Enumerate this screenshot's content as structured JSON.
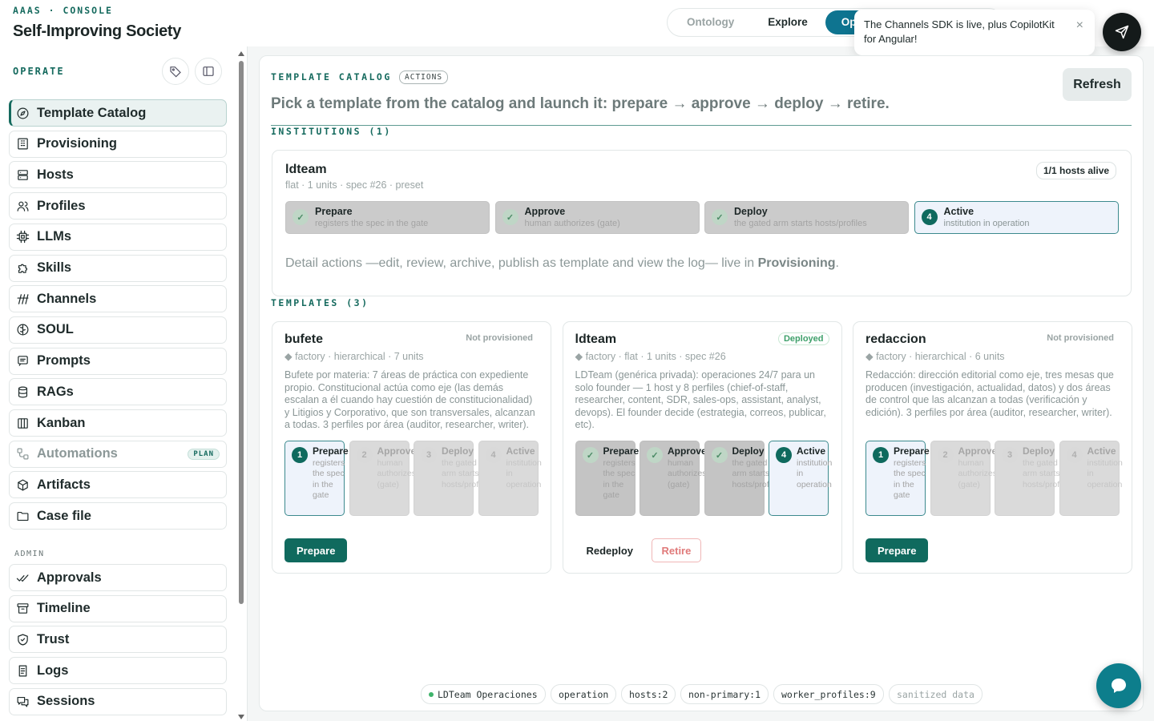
{
  "header": {
    "console_label": "AAAS · CONSOLE",
    "app_title": "Self-Improving Society",
    "nav": [
      {
        "label": "Ontology",
        "state": "dim"
      },
      {
        "label": "Explore",
        "state": "normal"
      },
      {
        "label": "Operate",
        "state": "active"
      }
    ]
  },
  "toast": {
    "message": "The Channels SDK is live, plus CopilotKit for Angular!",
    "close_label": "×"
  },
  "sidebar": {
    "operate_title": "OPERATE",
    "admin_title": "ADMIN",
    "operate_items": [
      {
        "label": "Template Catalog",
        "icon": "compass-icon",
        "active": true
      },
      {
        "label": "Provisioning",
        "icon": "building-icon"
      },
      {
        "label": "Hosts",
        "icon": "server-icon"
      },
      {
        "label": "Profiles",
        "icon": "users-icon"
      },
      {
        "label": "LLMs",
        "icon": "chip-icon"
      },
      {
        "label": "Skills",
        "icon": "puzzle-icon"
      },
      {
        "label": "Channels",
        "icon": "signal-icon"
      },
      {
        "label": "SOUL",
        "icon": "brain-icon"
      },
      {
        "label": "Prompts",
        "icon": "message-icon"
      },
      {
        "label": "RAGs",
        "icon": "database-icon"
      },
      {
        "label": "Kanban",
        "icon": "kanban-icon"
      },
      {
        "label": "Automations",
        "icon": "workflow-icon",
        "badge": "PLAN",
        "muted": true
      },
      {
        "label": "Artifacts",
        "icon": "package-icon"
      },
      {
        "label": "Case file",
        "icon": "folder-icon"
      }
    ],
    "admin_items": [
      {
        "label": "Approvals",
        "icon": "check-double-icon"
      },
      {
        "label": "Timeline",
        "icon": "archive-icon"
      },
      {
        "label": "Trust",
        "icon": "shield-icon"
      },
      {
        "label": "Logs",
        "icon": "scroll-icon"
      },
      {
        "label": "Sessions",
        "icon": "chat-icon"
      }
    ]
  },
  "main": {
    "section_title": "TEMPLATE CATALOG",
    "actions_badge": "ACTIONS",
    "refresh_label": "Refresh",
    "subtitle": "Pick a template from the catalog and launch it: prepare → approve → deploy → retire.",
    "institutions_title": "INSTITUTIONS (1)",
    "templates_title": "TEMPLATES (3)",
    "institution": {
      "name": "ldteam",
      "meta": "flat · 1 units · spec #26 · preset",
      "hosts_badge": "1/1 hosts alive",
      "stages": [
        {
          "name": "Prepare",
          "desc": "registers the spec in the gate",
          "state": "done",
          "mark": "✓"
        },
        {
          "name": "Approve",
          "desc": "human authorizes (gate)",
          "state": "done",
          "mark": "✓"
        },
        {
          "name": "Deploy",
          "desc": "the gated arm starts hosts/profiles",
          "state": "done",
          "mark": "✓"
        },
        {
          "name": "Active",
          "desc": "institution in operation",
          "state": "current",
          "mark": "4"
        }
      ],
      "detail_prefix": "Detail actions —edit, review, archive, publish as template and view the log— live in ",
      "detail_link": "Provisioning",
      "detail_suffix": "."
    },
    "templates": [
      {
        "name": "bufete",
        "meta": "◆ factory · hierarchical · 7 units",
        "status": "Not provisioned",
        "desc": "Bufete por materia: 7 áreas de práctica con expediente propio. Constitucional actúa como eje (las demás escalan a él cuando hay cuestión de constitucionalidad) y Litigios y Corporativo, que son transversales, alcanzan a todas. 3 perfiles por área (auditor, researcher, writer).",
        "stages": [
          {
            "name": "Prepare",
            "desc": "registers the spec in the gate",
            "state": "cur",
            "mark": "1"
          },
          {
            "name": "Approve",
            "desc": "human authorizes (gate)",
            "state": "pend",
            "mark": "2"
          },
          {
            "name": "Deploy",
            "desc": "the gated arm starts hosts/profiles",
            "state": "pend",
            "mark": "3"
          },
          {
            "name": "Active",
            "desc": "institution in operation",
            "state": "pend",
            "mark": "4"
          }
        ],
        "actions": [
          {
            "label": "Prepare",
            "kind": "primary"
          }
        ]
      },
      {
        "name": "ldteam",
        "meta": "◆ factory · flat · 1 units · spec #26",
        "status": "Deployed",
        "desc": "LDTeam (genérica privada): operaciones 24/7 para un solo founder — 1 host y 8 perfiles (chief-of-staff, researcher, content, SDR, sales-ops, assistant, analyst, devops). El founder decide (estrategia, correos, publicar, etc).",
        "stages": [
          {
            "name": "Prepare",
            "desc": "registers the spec in the gate",
            "state": "done",
            "mark": "✓"
          },
          {
            "name": "Approve",
            "desc": "human authorizes (gate)",
            "state": "done",
            "mark": "✓"
          },
          {
            "name": "Deploy",
            "desc": "the gated arm starts hosts/profiles",
            "state": "done",
            "mark": "✓"
          },
          {
            "name": "Active",
            "desc": "institution in operation",
            "state": "cur",
            "mark": "4"
          }
        ],
        "actions": [
          {
            "label": "Redeploy",
            "kind": "plain"
          },
          {
            "label": "Retire",
            "kind": "retire"
          }
        ]
      },
      {
        "name": "redaccion",
        "meta": "◆ factory · hierarchical · 6 units",
        "status": "Not provisioned",
        "desc": "Redacción: dirección editorial como eje, tres mesas que producen (investigación, actualidad, datos) y dos áreas de control que las alcanzan a todas (verificación y edición). 3 perfiles por área (auditor, researcher, writer).",
        "stages": [
          {
            "name": "Prepare",
            "desc": "registers the spec in the gate",
            "state": "cur",
            "mark": "1"
          },
          {
            "name": "Approve",
            "desc": "human authorizes (gate)",
            "state": "pend",
            "mark": "2"
          },
          {
            "name": "Deploy",
            "desc": "the gated arm starts hosts/profiles",
            "state": "pend",
            "mark": "3"
          },
          {
            "name": "Active",
            "desc": "institution in operation",
            "state": "pend",
            "mark": "4"
          }
        ],
        "actions": [
          {
            "label": "Prepare",
            "kind": "primary"
          }
        ]
      }
    ],
    "footer_chips": [
      {
        "label": "LDTeam Operaciones",
        "dot": true
      },
      {
        "label": "operation"
      },
      {
        "label": "hosts:2"
      },
      {
        "label": "non-primary:1"
      },
      {
        "label": "worker_profiles:9"
      },
      {
        "label": "sanitized data",
        "dim": true
      }
    ]
  },
  "colors": {
    "brand": "#156a5e",
    "accent": "#0e7490",
    "danger": "#e07a7a",
    "success": "#3ea06a"
  }
}
